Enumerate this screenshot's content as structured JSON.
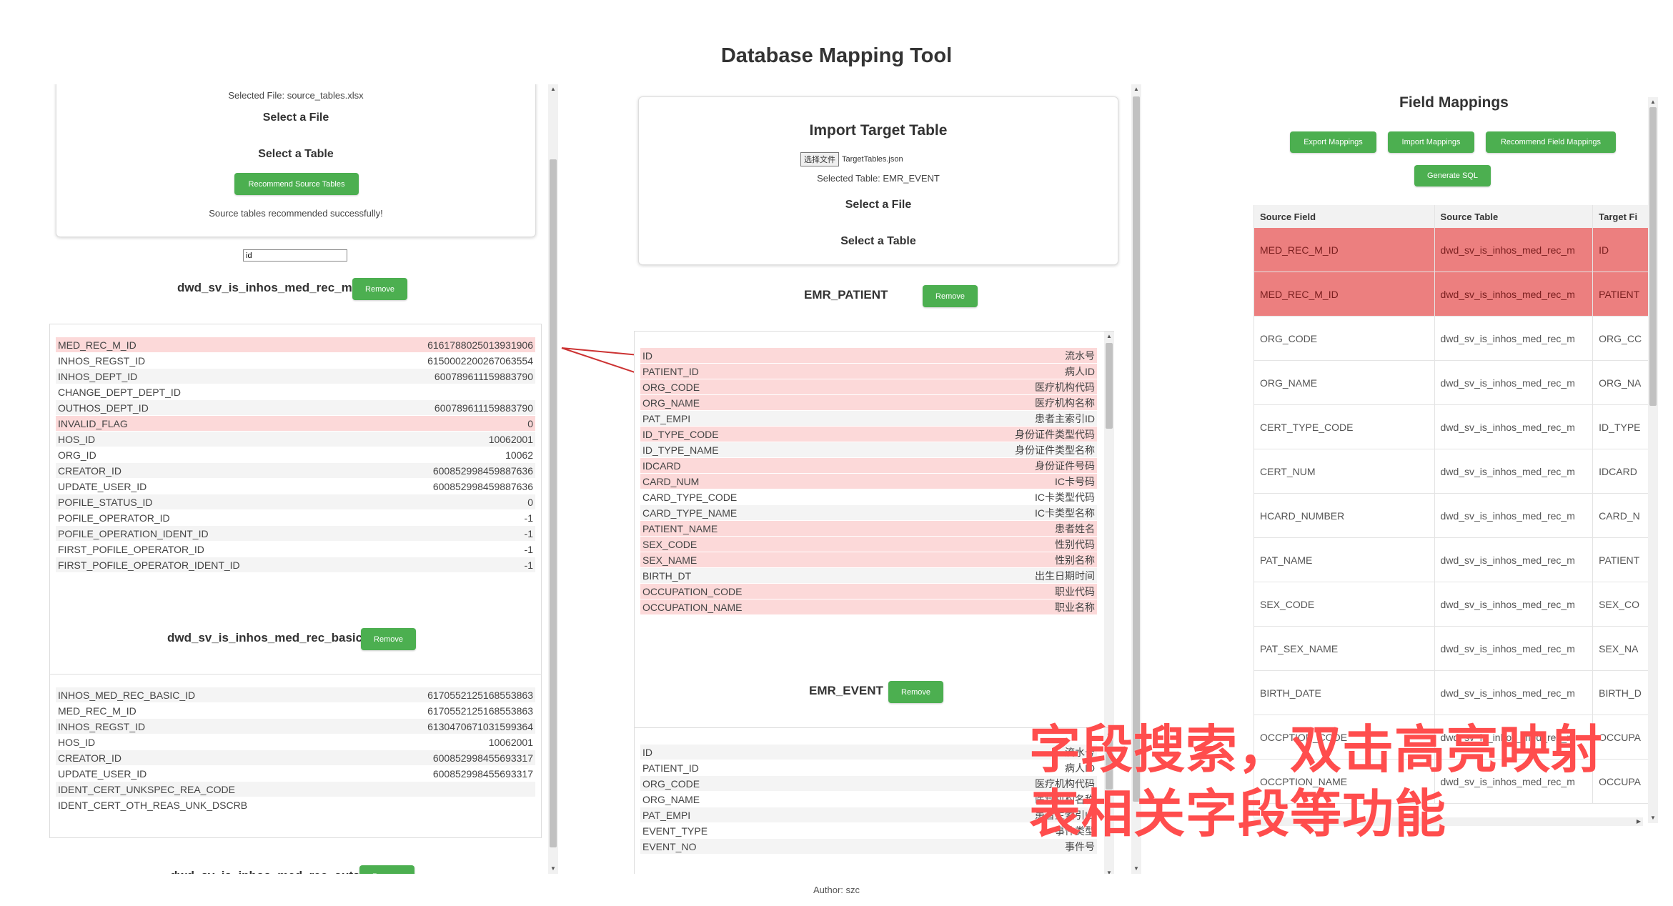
{
  "app": {
    "title": "Database Mapping Tool",
    "author": "Author: szc"
  },
  "source": {
    "selected_file": "Selected File: source_tables.xlsx",
    "select_file_label": "Select a File",
    "select_table_label": "Select a Table",
    "recommend_button": "Recommend Source Tables",
    "status": "Source tables recommended successfully!",
    "search_value": "id",
    "remove_label": "Remove",
    "tables": [
      {
        "name": "dwd_sv_is_inhos_med_rec_m",
        "rows": [
          {
            "field": "MED_REC_M_ID",
            "value": "6161788025013931906",
            "hl": true
          },
          {
            "field": "INHOS_REGST_ID",
            "value": "6150002200267063554",
            "hl": false
          },
          {
            "field": "INHOS_DEPT_ID",
            "value": "600789611159883790",
            "hl": false
          },
          {
            "field": "CHANGE_DEPT_DEPT_ID",
            "value": "",
            "hl": false
          },
          {
            "field": "OUTHOS_DEPT_ID",
            "value": "600789611159883790",
            "hl": false
          },
          {
            "field": "INVALID_FLAG",
            "value": "0",
            "hl": true
          },
          {
            "field": "HOS_ID",
            "value": "10062001",
            "hl": false
          },
          {
            "field": "ORG_ID",
            "value": "10062",
            "hl": false
          },
          {
            "field": "CREATOR_ID",
            "value": "600852998459887636",
            "hl": false
          },
          {
            "field": "UPDATE_USER_ID",
            "value": "600852998459887636",
            "hl": false
          },
          {
            "field": "POFILE_STATUS_ID",
            "value": "0",
            "hl": false
          },
          {
            "field": "POFILE_OPERATOR_ID",
            "value": "-1",
            "hl": false
          },
          {
            "field": "POFILE_OPERATION_IDENT_ID",
            "value": "-1",
            "hl": false
          },
          {
            "field": "FIRST_POFILE_OPERATOR_ID",
            "value": "-1",
            "hl": false
          },
          {
            "field": "FIRST_POFILE_OPERATOR_IDENT_ID",
            "value": "-1",
            "hl": false
          }
        ]
      },
      {
        "name": "dwd_sv_is_inhos_med_rec_basic",
        "rows": [
          {
            "field": "INHOS_MED_REC_BASIC_ID",
            "value": "6170552125168553863",
            "hl": false
          },
          {
            "field": "MED_REC_M_ID",
            "value": "6170552125168553863",
            "hl": false
          },
          {
            "field": "INHOS_REGST_ID",
            "value": "6130470671031599364",
            "hl": false
          },
          {
            "field": "HOS_ID",
            "value": "10062001",
            "hl": false
          },
          {
            "field": "CREATOR_ID",
            "value": "600852998455693317",
            "hl": false
          },
          {
            "field": "UPDATE_USER_ID",
            "value": "600852998455693317",
            "hl": false
          },
          {
            "field": "IDENT_CERT_UNKSPEC_REA_CODE",
            "value": "",
            "hl": false
          },
          {
            "field": "IDENT_CERT_OTH_REAS_UNK_DSCRB",
            "value": "",
            "hl": false
          }
        ]
      },
      {
        "name": "dwd_sv_is_inhos_med_rec_outs",
        "rows": []
      }
    ]
  },
  "target": {
    "import_title": "Import Target Table",
    "choose_file_button": "选择文件",
    "chosen_file": "TargetTables.json",
    "selected_table": "Selected Table: EMR_EVENT",
    "select_file_label": "Select a File",
    "select_table_label": "Select a Table",
    "remove_label": "Remove",
    "tables": [
      {
        "name": "EMR_PATIENT",
        "rows": [
          {
            "field": "ID",
            "value": "流水号",
            "hl": true
          },
          {
            "field": "PATIENT_ID",
            "value": "病人ID",
            "hl": true
          },
          {
            "field": "ORG_CODE",
            "value": "医疗机构代码",
            "hl": true
          },
          {
            "field": "ORG_NAME",
            "value": "医疗机构名称",
            "hl": true
          },
          {
            "field": "PAT_EMPI",
            "value": "患者主索引ID",
            "hl": false
          },
          {
            "field": "ID_TYPE_CODE",
            "value": "身份证件类型代码",
            "hl": true
          },
          {
            "field": "ID_TYPE_NAME",
            "value": "身份证件类型名称",
            "hl": false
          },
          {
            "field": "IDCARD",
            "value": "身份证件号码",
            "hl": true
          },
          {
            "field": "CARD_NUM",
            "value": "IC卡号码",
            "hl": true
          },
          {
            "field": "CARD_TYPE_CODE",
            "value": "IC卡类型代码",
            "hl": false
          },
          {
            "field": "CARD_TYPE_NAME",
            "value": "IC卡类型名称",
            "hl": false
          },
          {
            "field": "PATIENT_NAME",
            "value": "患者姓名",
            "hl": true
          },
          {
            "field": "SEX_CODE",
            "value": "性别代码",
            "hl": true
          },
          {
            "field": "SEX_NAME",
            "value": "性别名称",
            "hl": true
          },
          {
            "field": "BIRTH_DT",
            "value": "出生日期时间",
            "hl": false
          },
          {
            "field": "OCCUPATION_CODE",
            "value": "职业代码",
            "hl": true
          },
          {
            "field": "OCCUPATION_NAME",
            "value": "职业名称",
            "hl": true
          }
        ]
      },
      {
        "name": "EMR_EVENT",
        "rows": [
          {
            "field": "ID",
            "value": "流水号",
            "hl": false
          },
          {
            "field": "PATIENT_ID",
            "value": "病人ID",
            "hl": false
          },
          {
            "field": "ORG_CODE",
            "value": "医疗机构代码",
            "hl": false
          },
          {
            "field": "ORG_NAME",
            "value": "医疗机构名称",
            "hl": false
          },
          {
            "field": "PAT_EMPI",
            "value": "患者主索引ID",
            "hl": false
          },
          {
            "field": "EVENT_TYPE",
            "value": "事件类型",
            "hl": false
          },
          {
            "field": "EVENT_NO",
            "value": "事件号",
            "hl": false
          }
        ]
      }
    ]
  },
  "mappings": {
    "title": "Field Mappings",
    "buttons": {
      "export": "Export Mappings",
      "import": "Import Mappings",
      "recommend": "Recommend Field Mappings",
      "sql": "Generate SQL"
    },
    "columns": [
      "Source Field",
      "Source Table",
      "Target Fi"
    ],
    "rows": [
      {
        "source_field": "MED_REC_M_ID",
        "source_table": "dwd_sv_is_inhos_med_rec_m",
        "target": "ID",
        "hl": true
      },
      {
        "source_field": "MED_REC_M_ID",
        "source_table": "dwd_sv_is_inhos_med_rec_m",
        "target": "PATIENT",
        "hl": true
      },
      {
        "source_field": "ORG_CODE",
        "source_table": "dwd_sv_is_inhos_med_rec_m",
        "target": "ORG_CC",
        "hl": false
      },
      {
        "source_field": "ORG_NAME",
        "source_table": "dwd_sv_is_inhos_med_rec_m",
        "target": "ORG_NA",
        "hl": false
      },
      {
        "source_field": "CERT_TYPE_CODE",
        "source_table": "dwd_sv_is_inhos_med_rec_m",
        "target": "ID_TYPE",
        "hl": false
      },
      {
        "source_field": "CERT_NUM",
        "source_table": "dwd_sv_is_inhos_med_rec_m",
        "target": "IDCARD",
        "hl": false
      },
      {
        "source_field": "HCARD_NUMBER",
        "source_table": "dwd_sv_is_inhos_med_rec_m",
        "target": "CARD_N",
        "hl": false
      },
      {
        "source_field": "PAT_NAME",
        "source_table": "dwd_sv_is_inhos_med_rec_m",
        "target": "PATIENT",
        "hl": false
      },
      {
        "source_field": "SEX_CODE",
        "source_table": "dwd_sv_is_inhos_med_rec_m",
        "target": "SEX_CO",
        "hl": false
      },
      {
        "source_field": "PAT_SEX_NAME",
        "source_table": "dwd_sv_is_inhos_med_rec_m",
        "target": "SEX_NA",
        "hl": false
      },
      {
        "source_field": "BIRTH_DATE",
        "source_table": "dwd_sv_is_inhos_med_rec_m",
        "target": "BIRTH_D",
        "hl": false
      },
      {
        "source_field": "OCCPTION_CODE",
        "source_table": "dwd_sv_is_inhos_med_rec_m",
        "target": "OCCUPA",
        "hl": false
      },
      {
        "source_field": "OCCPTION_NAME",
        "source_table": "dwd_sv_is_inhos_med_rec_m",
        "target": "OCCUPA",
        "hl": false
      }
    ]
  },
  "overlay": {
    "line1": "字段搜索，双击高亮映射",
    "line2": "表相关字段等功能",
    "color": "#ff4d4d"
  },
  "colors": {
    "accent": "#4caf50",
    "highlight_row": "#fcd9d9",
    "mapping_highlight": "#ec7f7f",
    "connector": "#cc3333"
  }
}
